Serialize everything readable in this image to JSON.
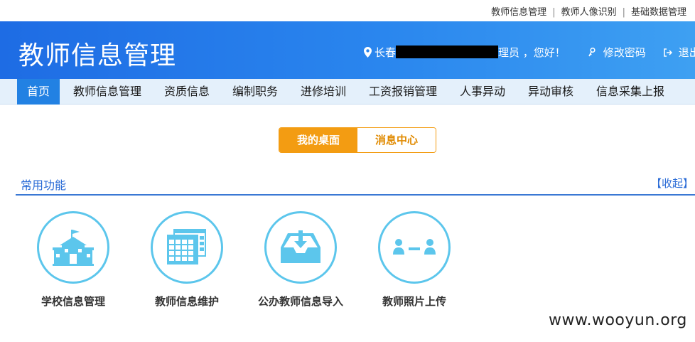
{
  "top_links": [
    "教师信息管理",
    "教师人像识别",
    "基础数据管理"
  ],
  "header": {
    "title": "教师信息管理",
    "user_prefix": "长春",
    "user_suffix": "理员 ，您好！",
    "change_password": "修改密码",
    "logout": "退出"
  },
  "nav": {
    "items": [
      "首页",
      "教师信息管理",
      "资质信息",
      "编制职务",
      "进修培训",
      "工资报销管理",
      "人事异动",
      "异动审核",
      "信息采集上报"
    ],
    "active": "首页"
  },
  "tabs": {
    "desktop": "我的桌面",
    "messages": "消息中心"
  },
  "section": {
    "title": "常用功能",
    "collapse": "【收起】"
  },
  "features": [
    {
      "label": "学校信息管理",
      "icon": "school-icon"
    },
    {
      "label": "教师信息维护",
      "icon": "calendar-table-icon"
    },
    {
      "label": "公办教师信息导入",
      "icon": "inbox-download-icon"
    },
    {
      "label": "教师照片上传",
      "icon": "users-link-icon"
    }
  ],
  "watermark": "www.wooyun.org",
  "colors": {
    "header_blue": "#2a86ee",
    "nav_bg": "#e4f0fb",
    "nav_active": "#2281e3",
    "orange": "#f39c12",
    "icon_cyan": "#5cc6ec",
    "section_blue": "#2a6bd6"
  }
}
